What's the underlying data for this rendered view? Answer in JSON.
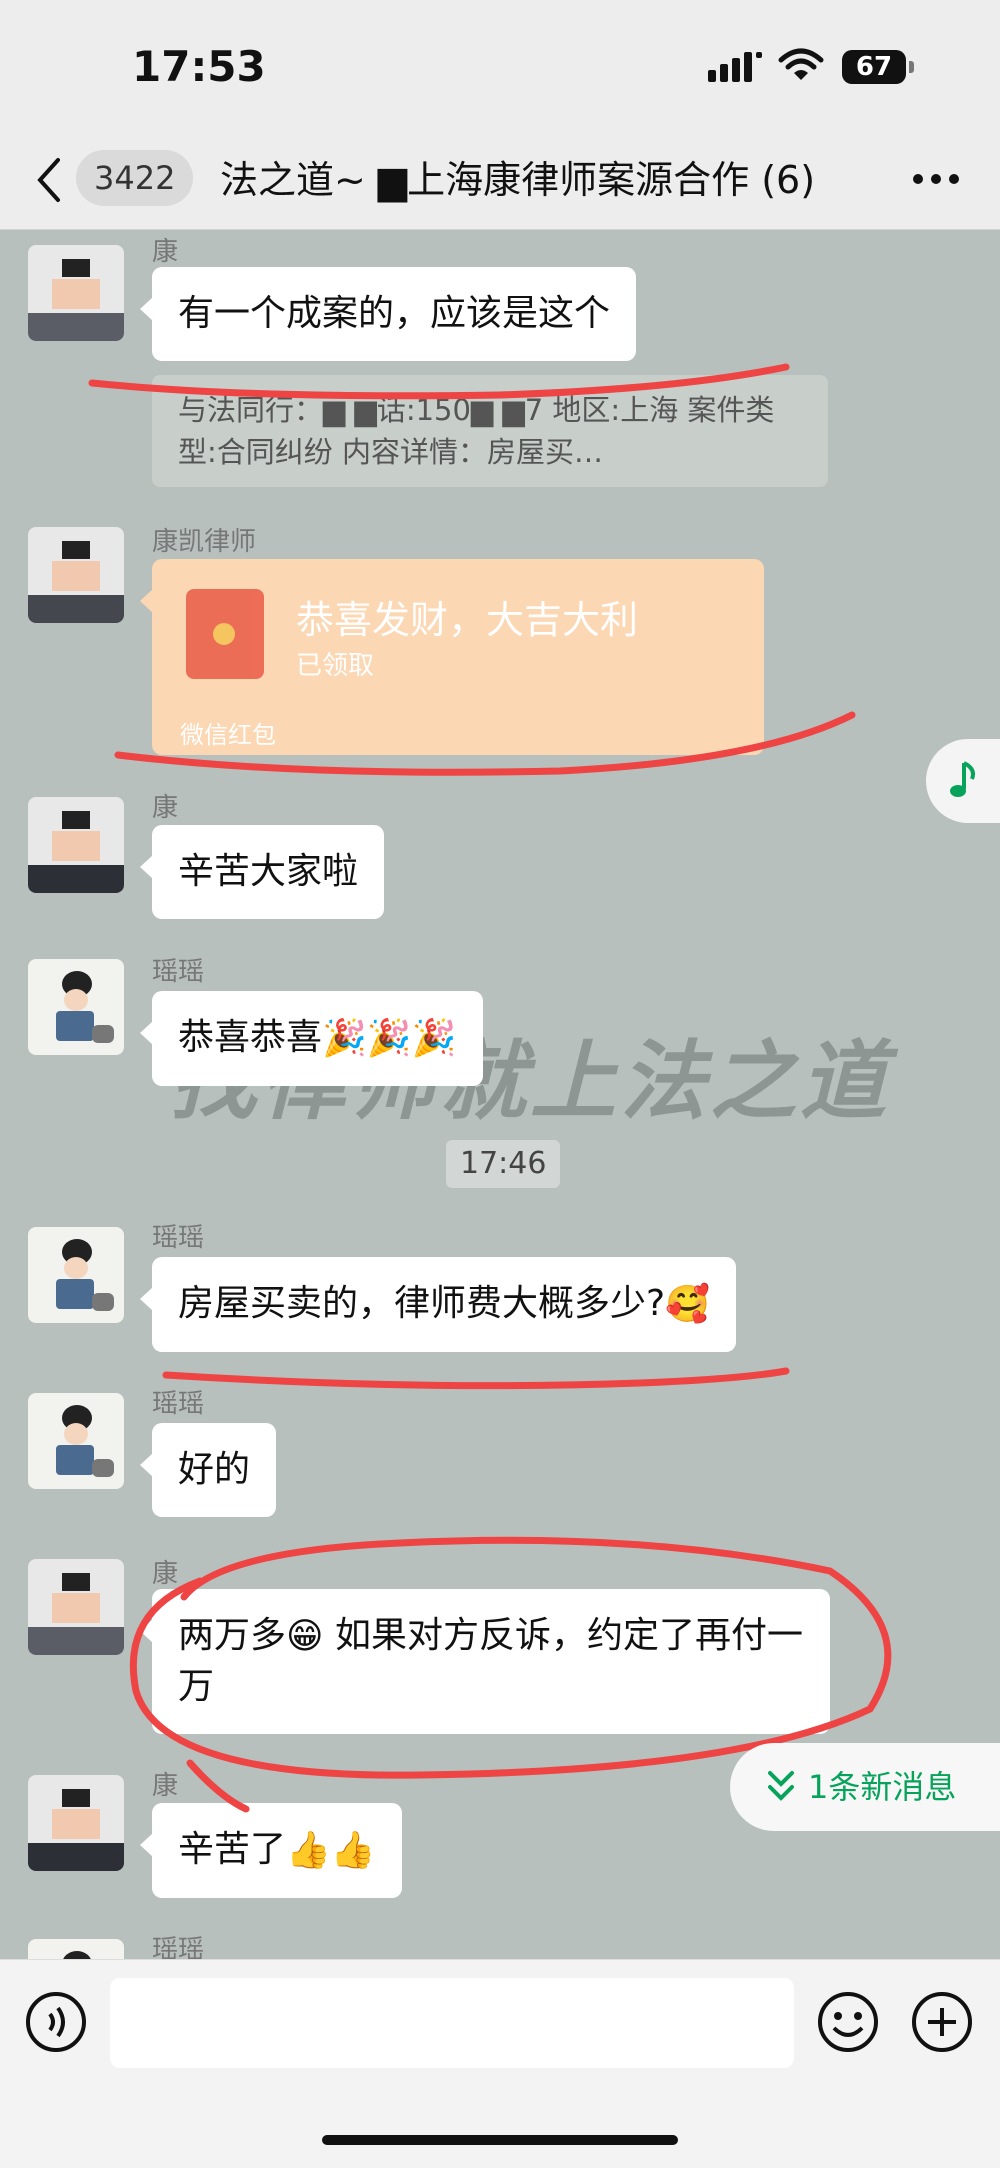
{
  "status_bar": {
    "time": "17:53",
    "battery": "67"
  },
  "header": {
    "unread_count": "3422",
    "title": "法之道~ ▆上海康律师案源合作 (6)"
  },
  "messages": [
    {
      "sender": "康",
      "text": "有一个成案的，应该是这个",
      "quote": "与法同行：▆ ▆话:150▆ ▆7 地区:上海 案件类型:合同纠纷 内容详情：房屋买…"
    },
    {
      "sender": "康凯律师",
      "red_packet": {
        "title": "恭喜发财，大吉大利",
        "status": "已领取",
        "footer": "微信红包"
      }
    },
    {
      "sender": "康",
      "text": "辛苦大家啦"
    },
    {
      "sender": "瑶瑶",
      "text": "恭喜恭喜",
      "emoji": "🎉🎉🎉"
    },
    {
      "timestamp": "17:46"
    },
    {
      "sender": "瑶瑶",
      "text": "房屋买卖的，律师费大概多少?",
      "emoji": "🥰"
    },
    {
      "sender": "瑶瑶",
      "text": "好的"
    },
    {
      "sender": "康",
      "text_a": "两万多",
      "emoji": "😁",
      "text_b": " 如果对方反诉，约定了再付一万"
    },
    {
      "sender": "康",
      "text": "辛苦了",
      "emoji": "👍👍"
    },
    {
      "sender": "瑶瑶"
    }
  ],
  "watermark": "找律师就上法之道",
  "new_messages": "1条新消息",
  "input": {
    "value": ""
  },
  "colors": {
    "accent": "#07a35b",
    "annotation": "#ee4444",
    "bubble": "#ffffff",
    "chat_bg": "#b8c0bd"
  },
  "icons": [
    "back-icon",
    "more-icon",
    "music-icon",
    "chevron-down-icon",
    "voice-icon",
    "emoji-face-icon",
    "plus-icon"
  ]
}
